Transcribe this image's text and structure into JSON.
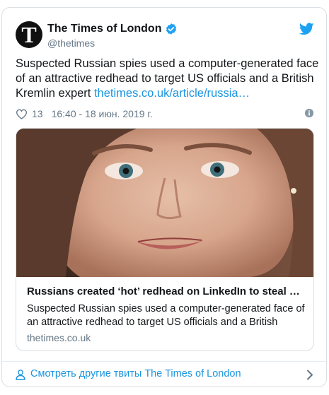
{
  "tweet": {
    "avatar_letter": "T",
    "author_name": "The Times of London",
    "handle": "@thetimes",
    "text": "Suspected Russian spies used a computer-generated face of an attractive redhead to target US officials and a British Kremlin expert ",
    "link_text": "thetimes.co.uk/article/russia…",
    "likes": "13",
    "timestamp": "16:40 - 18 июн. 2019 г."
  },
  "card": {
    "title": "Russians created ‘hot’ redhead on LinkedIn to steal milit…",
    "description": "Suspected Russian spies used a computer-generated face of an attractive redhead to target US officials and a British",
    "domain": "thetimes.co.uk"
  },
  "footer": {
    "label": "Смотреть другие твиты The Times of London"
  },
  "colors": {
    "link": "#1b95e0",
    "muted": "#657786",
    "border": "#d9dfe3"
  },
  "icons": [
    "verified-icon",
    "twitter-bird-icon",
    "heart-icon",
    "info-icon",
    "person-icon",
    "chevron-right-icon"
  ]
}
